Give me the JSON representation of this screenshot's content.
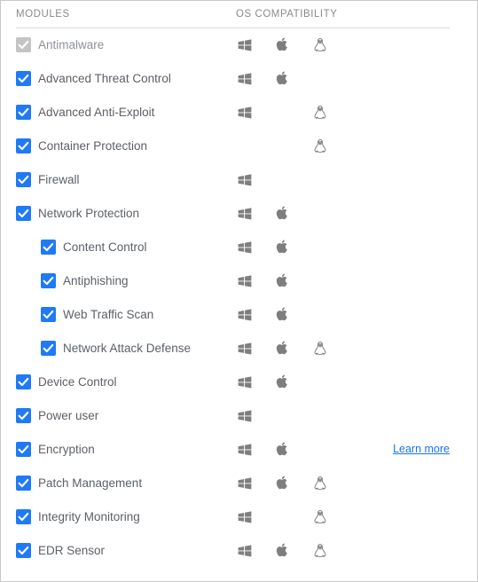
{
  "colors": {
    "checkbox_checked": "#1f7af5",
    "checkbox_disabled": "#c4c4c4",
    "link": "#1a73e8",
    "label_text": "#5c6066",
    "header_text": "#8a8a8a",
    "icon_gray": "#7e7e7e",
    "panel_border": "#c9c9c9",
    "rule": "#d9d9d9"
  },
  "header": {
    "modules_label": "MODULES",
    "os_compatibility_label": "OS COMPATIBILITY"
  },
  "icons": {
    "windows": "windows-icon",
    "macos": "apple-icon",
    "linux": "linux-penguin-icon",
    "check": "check-icon"
  },
  "links": {
    "learn_more": "Learn more"
  },
  "rows": [
    {
      "label": "Antimalware",
      "nested": false,
      "checked": true,
      "disabled": true,
      "os": {
        "windows": true,
        "macos": true,
        "linux": true
      },
      "learn_more": false
    },
    {
      "label": "Advanced Threat Control",
      "nested": false,
      "checked": true,
      "disabled": false,
      "os": {
        "windows": true,
        "macos": true,
        "linux": false
      },
      "learn_more": false
    },
    {
      "label": "Advanced Anti-Exploit",
      "nested": false,
      "checked": true,
      "disabled": false,
      "os": {
        "windows": true,
        "macos": false,
        "linux": true
      },
      "learn_more": false
    },
    {
      "label": "Container Protection",
      "nested": false,
      "checked": true,
      "disabled": false,
      "os": {
        "windows": false,
        "macos": false,
        "linux": true
      },
      "learn_more": false
    },
    {
      "label": "Firewall",
      "nested": false,
      "checked": true,
      "disabled": false,
      "os": {
        "windows": true,
        "macos": false,
        "linux": false
      },
      "learn_more": false
    },
    {
      "label": "Network Protection",
      "nested": false,
      "checked": true,
      "disabled": false,
      "os": {
        "windows": true,
        "macos": true,
        "linux": false
      },
      "learn_more": false
    },
    {
      "label": "Content Control",
      "nested": true,
      "checked": true,
      "disabled": false,
      "os": {
        "windows": true,
        "macos": true,
        "linux": false
      },
      "learn_more": false
    },
    {
      "label": "Antiphishing",
      "nested": true,
      "checked": true,
      "disabled": false,
      "os": {
        "windows": true,
        "macos": true,
        "linux": false
      },
      "learn_more": false
    },
    {
      "label": "Web Traffic Scan",
      "nested": true,
      "checked": true,
      "disabled": false,
      "os": {
        "windows": true,
        "macos": true,
        "linux": false
      },
      "learn_more": false
    },
    {
      "label": "Network Attack Defense",
      "nested": true,
      "checked": true,
      "disabled": false,
      "os": {
        "windows": true,
        "macos": true,
        "linux": true
      },
      "learn_more": false
    },
    {
      "label": "Device Control",
      "nested": false,
      "checked": true,
      "disabled": false,
      "os": {
        "windows": true,
        "macos": true,
        "linux": false
      },
      "learn_more": false
    },
    {
      "label": "Power user",
      "nested": false,
      "checked": true,
      "disabled": false,
      "os": {
        "windows": true,
        "macos": false,
        "linux": false
      },
      "learn_more": false
    },
    {
      "label": "Encryption",
      "nested": false,
      "checked": true,
      "disabled": false,
      "os": {
        "windows": true,
        "macos": true,
        "linux": false
      },
      "learn_more": true
    },
    {
      "label": "Patch Management",
      "nested": false,
      "checked": true,
      "disabled": false,
      "os": {
        "windows": true,
        "macos": true,
        "linux": true
      },
      "learn_more": false
    },
    {
      "label": "Integrity Monitoring",
      "nested": false,
      "checked": true,
      "disabled": false,
      "os": {
        "windows": true,
        "macos": false,
        "linux": true
      },
      "learn_more": false
    },
    {
      "label": "EDR Sensor",
      "nested": false,
      "checked": true,
      "disabled": false,
      "os": {
        "windows": true,
        "macos": true,
        "linux": true
      },
      "learn_more": false
    }
  ]
}
